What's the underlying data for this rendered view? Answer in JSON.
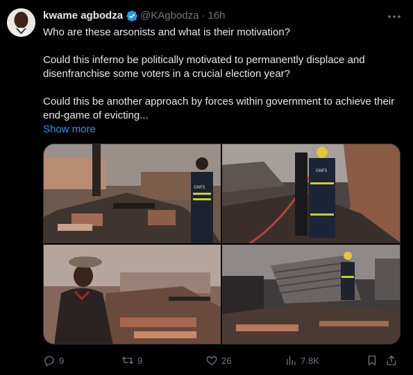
{
  "tweet": {
    "author_name": "kwame agbodza",
    "handle": "@KAgbodza",
    "separator": "·",
    "timestamp": "16h",
    "paragraphs": [
      "Who are these arsonists and what is their motivation?",
      "Could this inferno be politically motivated to permanently displace and disenfranchise some voters in a crucial election year?",
      "Could this be another approach by forces within government to achieve their end-game of evicting..."
    ],
    "show_more_label": "Show more",
    "verified_color": "#1d9bf0",
    "link_color": "#1d9bf0"
  },
  "photo_text": {
    "vest_label": "GNFS"
  },
  "actions": {
    "replies": "9",
    "reposts": "9",
    "likes": "26",
    "views": "7.8K",
    "icons": [
      "reply-icon",
      "retweet-icon",
      "heart-icon",
      "views-icon",
      "bookmark-icon",
      "share-icon"
    ]
  }
}
